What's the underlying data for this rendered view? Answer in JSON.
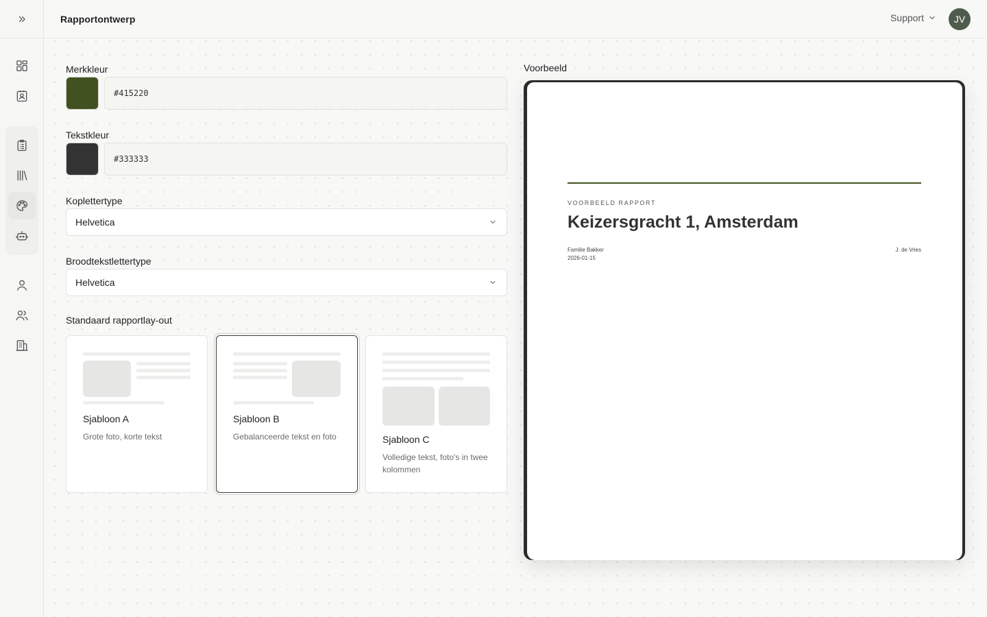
{
  "header": {
    "title": "Rapportontwerp",
    "support_label": "Support",
    "avatar_initials": "JV"
  },
  "nav": {
    "icons": [
      "dashboard-icon",
      "contact-icon",
      "clipboard-icon",
      "library-icon",
      "palette-icon",
      "robot-icon",
      "user-icon",
      "users-icon",
      "building-icon"
    ],
    "active": "palette-icon"
  },
  "form": {
    "brand_color": {
      "label": "Merkkleur",
      "value": "#415220"
    },
    "text_color": {
      "label": "Tekstkleur",
      "value": "#333333"
    },
    "heading_font": {
      "label": "Koplettertype",
      "value": "Helvetica"
    },
    "body_font": {
      "label": "Broodtekstlettertype",
      "value": "Helvetica"
    },
    "layout": {
      "label": "Standaard rapportlay-out",
      "templates": [
        {
          "name": "Sjabloon A",
          "description": "Grote foto, korte tekst",
          "selected": false
        },
        {
          "name": "Sjabloon B",
          "description": "Gebalanceerde tekst en foto",
          "selected": true
        },
        {
          "name": "Sjabloon C",
          "description": "Volledige tekst, foto's in twee kolommen",
          "selected": false
        }
      ]
    }
  },
  "preview": {
    "label": "Voorbeeld",
    "kicker": "VOORBEELD RAPPORT",
    "title": "Keizersgracht 1, Amsterdam",
    "client": "Familie Bakker",
    "date": "2026-01-15",
    "author": "J. de Vries"
  }
}
